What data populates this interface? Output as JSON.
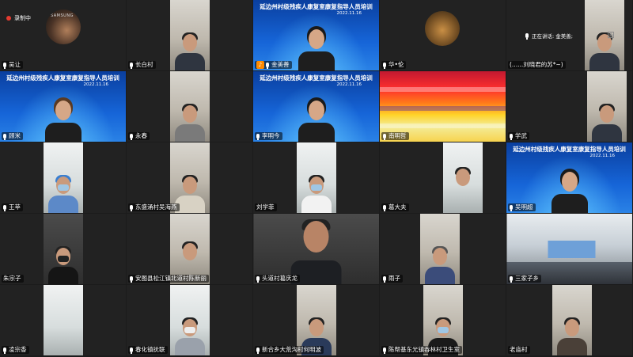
{
  "recording": {
    "label": "录制中"
  },
  "speaking": {
    "text": "正在讲话: 金美善;"
  },
  "banner": {
    "title": "延边州村级残疾人康复室康复指导人员培训",
    "date": "2022.11.16"
  },
  "avatar_brand": "SAMSUNG",
  "tiles": [
    {
      "name": "吴让"
    },
    {
      "name": "长白村"
    },
    {
      "name": "金美善"
    },
    {
      "name": "华•伦"
    },
    {
      "name": "(......刘晓君的苏*~)"
    },
    {
      "name": "顾米"
    },
    {
      "name": "永春"
    },
    {
      "name": "李明今"
    },
    {
      "name": "南明哲"
    },
    {
      "name": "学武"
    },
    {
      "name": "王苹"
    },
    {
      "name": "东盛涌村吴海燕"
    },
    {
      "name": "刘学菲"
    },
    {
      "name": "葛大夫"
    },
    {
      "name": "吴明超"
    },
    {
      "name": "朱宗子"
    },
    {
      "name": "安图县松江镇北道村陈新丽"
    },
    {
      "name": "头道村葛庆龙"
    },
    {
      "name": "雨子"
    },
    {
      "name": "三家子乡"
    },
    {
      "name": "凌宗香"
    },
    {
      "name": "春化镇抚联"
    },
    {
      "name": "新合乡大荒沟村何明波"
    },
    {
      "name": "陈帮基东光镇吞林村卫生室"
    },
    {
      "name": "老庙村"
    }
  ],
  "icons": {
    "mic": "microphone-icon",
    "speaker": "active-speaker-icon",
    "layout": "gallery-layout-icon"
  },
  "colors": {
    "background": "#1b1b1b",
    "record_dot": "#e43b30",
    "speaker_badge": "#ff8a00",
    "banner_blue": "#1665d8"
  }
}
